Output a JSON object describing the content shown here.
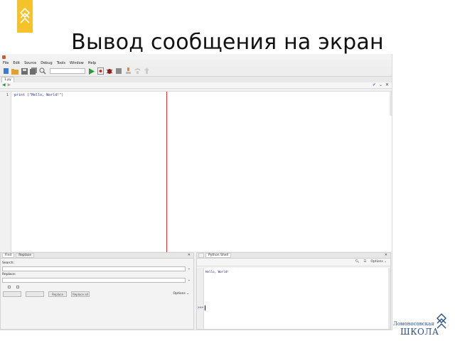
{
  "slide": {
    "title": "Вывод сообщения на экран"
  },
  "ide": {
    "window_title": "",
    "menu": [
      "File",
      "Edit",
      "Source",
      "Debug",
      "Tools",
      "Window",
      "Help"
    ],
    "editor_tab": "1.py",
    "code": {
      "line_numbers": [
        "1"
      ],
      "lines": [
        "print (\"Hello, World!\")"
      ]
    },
    "find_panel": {
      "tabs": [
        "Find",
        "Replace"
      ],
      "search_label": "Search:",
      "replace_label": "Replace:",
      "option_labels": [
        "",
        "",
        ""
      ],
      "buttons": [
        "",
        "",
        "Replace",
        "Replace all"
      ],
      "options_link": "Options"
    },
    "console_panel": {
      "tabs": [
        "",
        "Python Shell"
      ],
      "banner": "",
      "options_link": "Options",
      "output_lines": [
        "",
        "",
        "",
        "Hello, World!"
      ],
      "prompt": ">>>"
    }
  },
  "brand": {
    "top": "Ломоносовская",
    "main": "ШКОЛА"
  },
  "colors": {
    "accent_yellow": "#f4c22b",
    "margin_line": "#d23b3b",
    "brand_blue": "#2a4d87",
    "run_green": "#2d9a33",
    "stop_red": "#cc2a2a"
  }
}
